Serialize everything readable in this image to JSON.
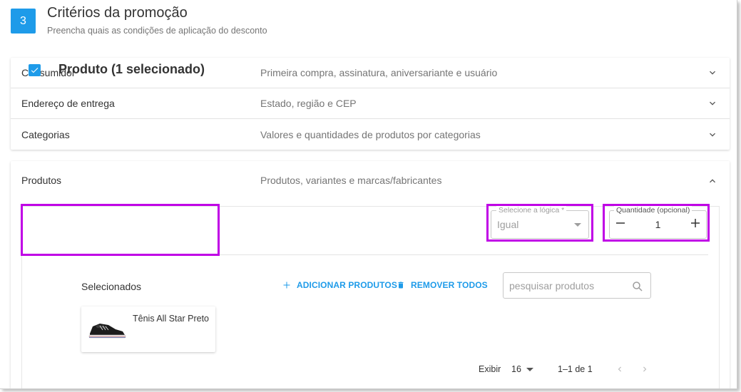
{
  "step": {
    "number": "3",
    "title": "Critérios da promoção",
    "subtitle": "Preencha quais as condições de aplicação do desconto"
  },
  "accordion": [
    {
      "title": "Consumidor",
      "description": "Primeira compra, assinatura, aniversariante e usuário",
      "state": "collapsed"
    },
    {
      "title": "Endereço de entrega",
      "description": "Estado, região e CEP",
      "state": "collapsed"
    },
    {
      "title": "Categorias",
      "description": "Valores e quantidades de produtos por categorias",
      "state": "collapsed"
    }
  ],
  "products_section": {
    "title": "Produtos",
    "description": "Produtos, variantes e marcas/fabricantes",
    "state": "expanded",
    "product_checkbox": {
      "checked": true,
      "label": "Produto (1 selecionado)"
    },
    "logic_select": {
      "label": "Selecione a lógica *",
      "value": "Igual"
    },
    "quantity": {
      "label": "Quantidade (opcional)",
      "value": "1"
    },
    "selected_label": "Selecionados",
    "add_button": "ADICIONAR PRODUTOS",
    "remove_button": "REMOVER TODOS",
    "search": {
      "placeholder": "pesquisar produtos"
    },
    "items": [
      {
        "name": "Tênis All Star Preto"
      }
    ],
    "pagination": {
      "show_label": "Exibir",
      "per_page": "16",
      "range": "1–1 de 1"
    }
  },
  "colors": {
    "accent": "#1e9be9",
    "highlight": "#c000e6"
  }
}
